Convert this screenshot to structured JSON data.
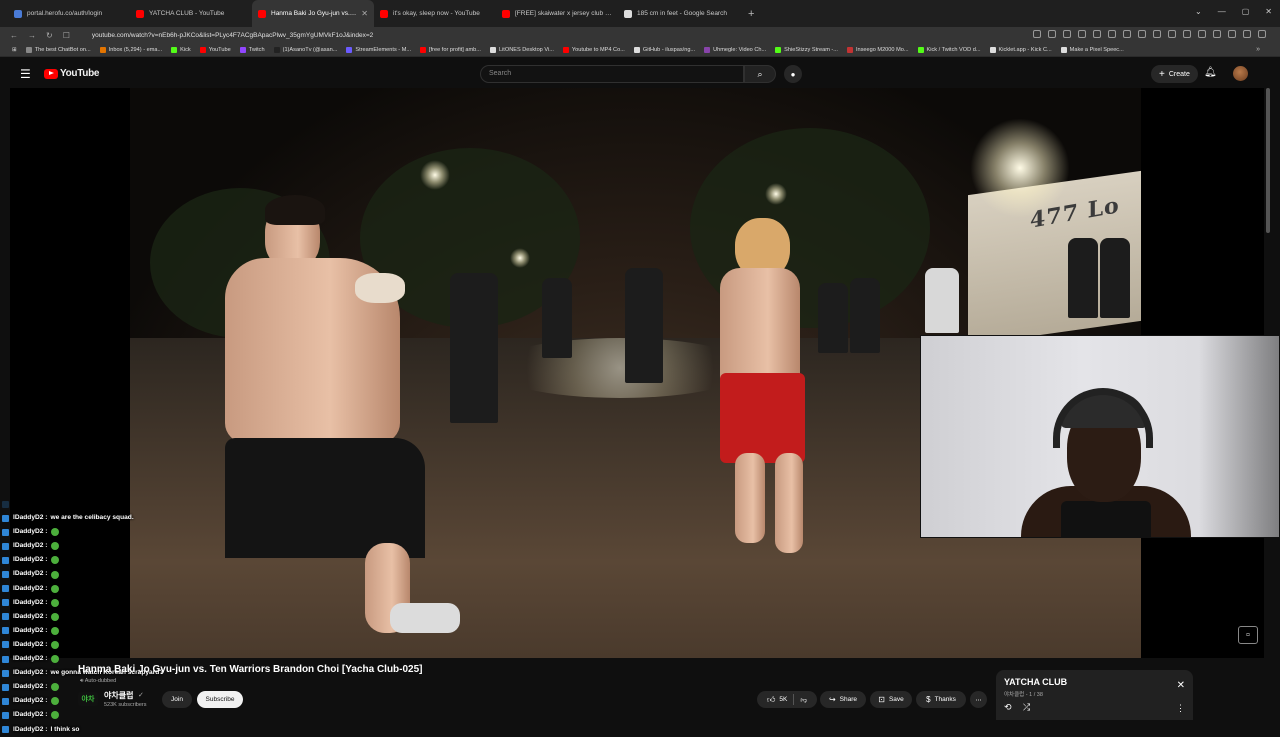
{
  "browser": {
    "tabs": [
      {
        "label": "portal.herofu.co/auth/login",
        "color": "#4a7bd6",
        "active": false
      },
      {
        "label": "YATCHA CLUB - YouTube",
        "color": "#ff0000",
        "active": false
      },
      {
        "label": "Hanma Baki Jo Gyu-jun vs. Te",
        "color": "#ff0000",
        "active": true
      },
      {
        "label": "it's okay, sleep now - YouTube",
        "color": "#ff0000",
        "active": false
      },
      {
        "label": "[FREE] skaiwater x jersey club type b",
        "color": "#ff0000",
        "active": false
      },
      {
        "label": "185 cm in feet - Google Search",
        "color": "#dddddd",
        "active": false
      }
    ],
    "new_tab": "+",
    "url": "youtube.com/watch?v=nEb6h-pJKCo&list=PLyc4F7ACgBApacPlwv_35gmYgUMVkF1oJ&index=2",
    "bookmarks": [
      {
        "label": "The best ChatBot on...",
        "color": "#888888"
      },
      {
        "label": "Inbox (5,294) - ema...",
        "color": "#e37400"
      },
      {
        "label": "Kick",
        "color": "#53fc18"
      },
      {
        "label": "YouTube",
        "color": "#ff0000"
      },
      {
        "label": "Twitch",
        "color": "#9146ff"
      },
      {
        "label": "(1)AsanoTv (@asan...",
        "color": "#222222"
      },
      {
        "label": "StreamElements - M...",
        "color": "#6b5bff"
      },
      {
        "label": "[free for profit] amb...",
        "color": "#ff0000"
      },
      {
        "label": "LitONES Desktop Vi...",
        "color": "#dddddd"
      },
      {
        "label": "Youtube to MP4 Co...",
        "color": "#ff0000"
      },
      {
        "label": "GitHub - iluspas/ng...",
        "color": "#dddddd"
      },
      {
        "label": "Uhmegle: Video Ch...",
        "color": "#8844aa"
      },
      {
        "label": "ShieStizzy Stream -...",
        "color": "#53fc18"
      },
      {
        "label": "Inseego M2000 Mo...",
        "color": "#c33333"
      },
      {
        "label": "Kick / Twitch VOD d...",
        "color": "#53fc18"
      },
      {
        "label": "Kicklet.app - Kick C...",
        "color": "#dddddd"
      },
      {
        "label": "Make a Pixel Speec...",
        "color": "#dddddd"
      }
    ],
    "bookmarks_more": "»"
  },
  "youtube": {
    "logo_text": "YouTube",
    "search_placeholder": "Search",
    "create_label": "Create",
    "video": {
      "building_sign": "477 Lo"
    },
    "title": "Hanma Baki Jo Gyu-jun vs. Ten Warriors Brandon Choi [Yacha Club-025]",
    "auto_dubbed": "Auto-dubbed",
    "channel": {
      "avatar_text": "야차",
      "name": "야차클럽",
      "subscribers": "523K subscribers"
    },
    "join_label": "Join",
    "subscribe_label": "Subscribe",
    "like_count": "5K",
    "share_label": "Share",
    "save_label": "Save",
    "thanks_label": "Thanks",
    "playlist": {
      "title": "YATCHA CLUB",
      "subtitle": "야차클럽 - 1 / 38"
    }
  },
  "chat": [
    {
      "user": "",
      "msg": "",
      "emote": false,
      "faded": true
    },
    {
      "user": "lDaddyD2 :",
      "msg": "we are the celibacy squad.",
      "emote": false,
      "faded": false
    },
    {
      "user": "lDaddyD2 :",
      "msg": "",
      "emote": true,
      "faded": false
    },
    {
      "user": "lDaddyD2 :",
      "msg": "",
      "emote": true,
      "faded": false
    },
    {
      "user": "lDaddyD2 :",
      "msg": "",
      "emote": true,
      "faded": false
    },
    {
      "user": "lDaddyD2 :",
      "msg": "",
      "emote": true,
      "faded": false
    },
    {
      "user": "lDaddyD2 :",
      "msg": "",
      "emote": true,
      "faded": false
    },
    {
      "user": "lDaddyD2 :",
      "msg": "",
      "emote": true,
      "faded": false
    },
    {
      "user": "lDaddyD2 :",
      "msg": "",
      "emote": true,
      "faded": false
    },
    {
      "user": "lDaddyD2 :",
      "msg": "",
      "emote": true,
      "faded": false
    },
    {
      "user": "lDaddyD2 :",
      "msg": "",
      "emote": true,
      "faded": false
    },
    {
      "user": "lDaddyD2 :",
      "msg": "",
      "emote": true,
      "faded": false
    },
    {
      "user": "lDaddyD2 :",
      "msg": "we gonna watch Korean scrapyard?",
      "emote": false,
      "faded": false
    },
    {
      "user": "lDaddyD2 :",
      "msg": "",
      "emote": true,
      "faded": false
    },
    {
      "user": "lDaddyD2 :",
      "msg": "",
      "emote": true,
      "faded": false
    },
    {
      "user": "lDaddyD2 :",
      "msg": "",
      "emote": true,
      "faded": false
    },
    {
      "user": "lDaddyD2 :",
      "msg": "I think so",
      "emote": false,
      "faded": false
    }
  ]
}
